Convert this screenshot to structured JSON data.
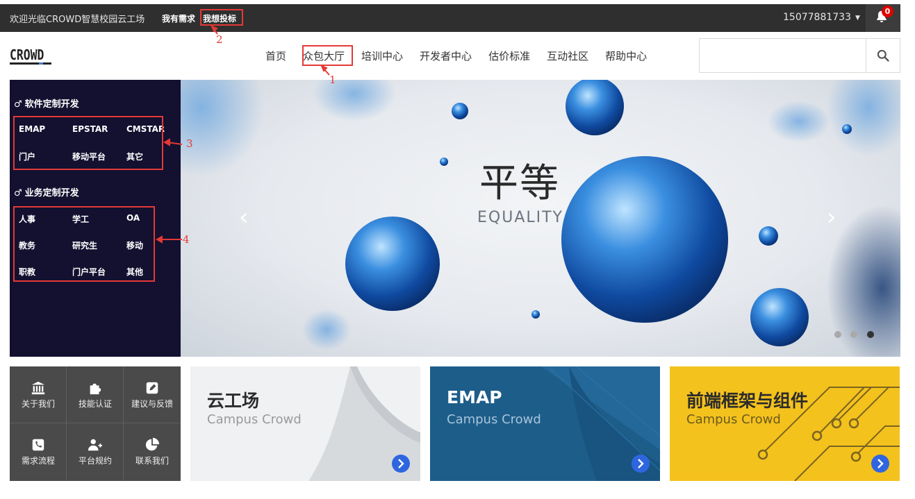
{
  "topbar": {
    "welcome": "欢迎光临CROWD智慧校园云工场",
    "need_link": "我有需求",
    "bid_link": "我想投标",
    "phone": "15077881733",
    "notification_count": "0"
  },
  "logo": {
    "text": "CROWD"
  },
  "nav": {
    "items": [
      "首页",
      "众包大厅",
      "培训中心",
      "开发者中心",
      "估价标准",
      "互动社区",
      "帮助中心"
    ]
  },
  "search": {
    "placeholder": ""
  },
  "annotations": [
    "1",
    "2",
    "3",
    "4"
  ],
  "sidebar": {
    "categories": [
      {
        "title": "软件定制开发",
        "items": [
          "EMAP",
          "EPSTAR",
          "CMSTAR",
          "门户",
          "移动平台",
          "其它"
        ]
      },
      {
        "title": "业务定制开发",
        "items": [
          "人事",
          "学工",
          "OA",
          "教务",
          "研究生",
          "移动",
          "职教",
          "门户平台",
          "其他"
        ]
      }
    ]
  },
  "banner": {
    "title": "平等",
    "subtitle": "EQUALITY",
    "slide_count": 3,
    "active_slide": 3
  },
  "quick_links": [
    "关于我们",
    "技能认证",
    "建议与反馈",
    "需求流程",
    "平台规约",
    "联系我们"
  ],
  "cards": [
    {
      "title": "云工场",
      "subtitle": "Campus Crowd",
      "bg": "#eff1f3",
      "title_color": "#2b2b2b",
      "sub_color": "#9a9a9a"
    },
    {
      "title": "EMAP",
      "subtitle": "Campus Crowd",
      "bg": "#1d5d8a",
      "title_color": "#ffffff",
      "sub_color": "#a9c4da"
    },
    {
      "title": "前端框架与组件",
      "subtitle": "Campus Crowd",
      "bg": "#f4c21d",
      "title_color": "#2b2b2b",
      "sub_color": "#6b5a1e"
    }
  ],
  "colors": {
    "topbar": "#2f2f2f",
    "sidebar": "#131030",
    "annotation": "#e53935",
    "card_button": "#2f66e0"
  }
}
